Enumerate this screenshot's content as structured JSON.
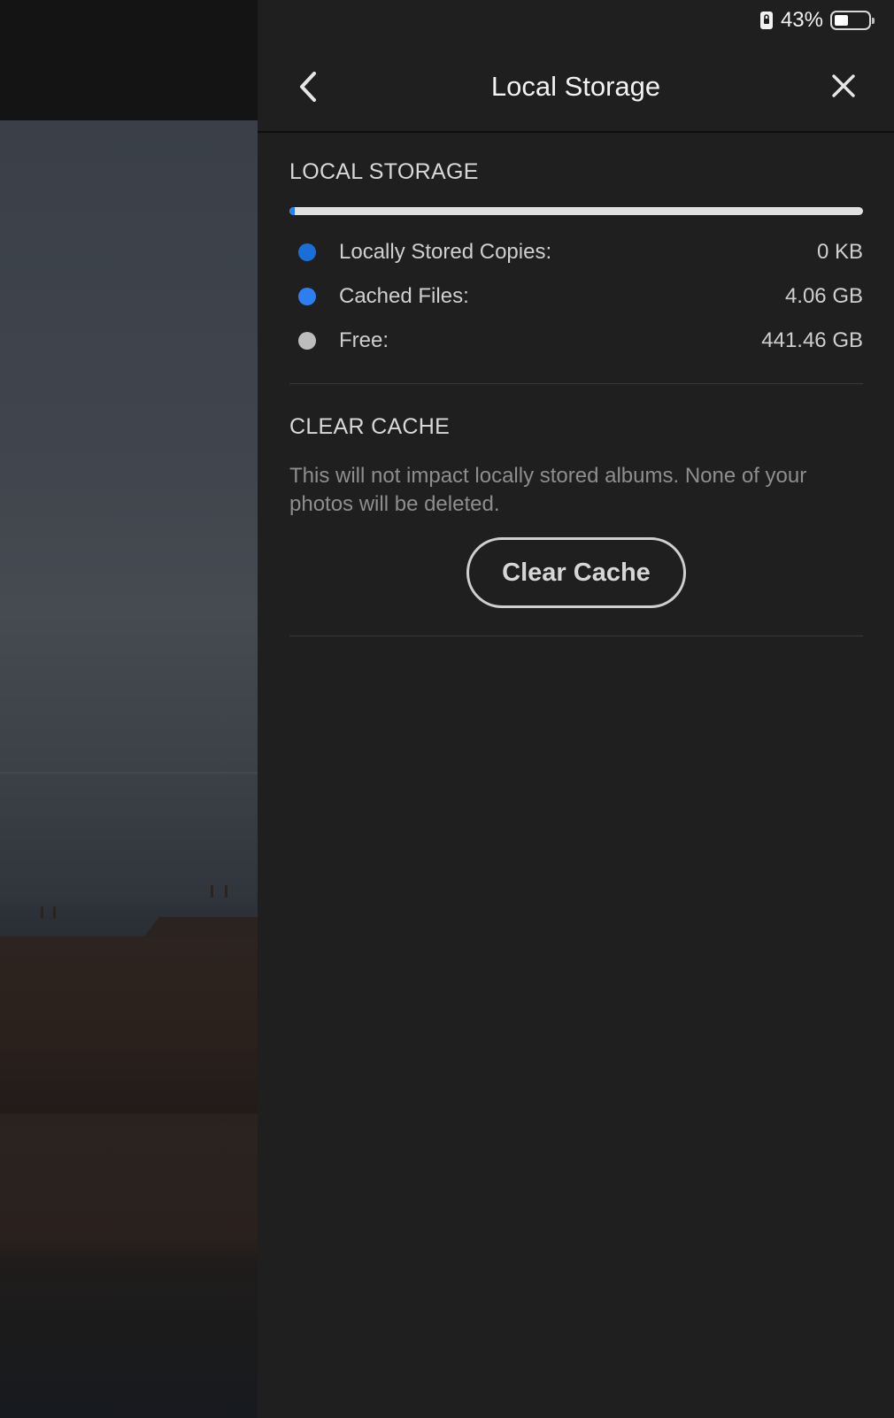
{
  "status_bar": {
    "battery_percent_label": "43%",
    "battery_level": 0.43
  },
  "header": {
    "title": "Local Storage"
  },
  "local_storage": {
    "heading": "LOCAL STORAGE",
    "usage": {
      "locally_stored_fraction": 0.0,
      "cached_fraction": 0.009
    },
    "items": [
      {
        "label": "Locally Stored Copies:",
        "value": "0 KB",
        "color": "#1a6ed8"
      },
      {
        "label": "Cached Files:",
        "value": "4.06 GB",
        "color": "#2d7ff0"
      },
      {
        "label": "Free:",
        "value": "441.46 GB",
        "color": "#bdbdbd"
      }
    ]
  },
  "clear_cache": {
    "heading": "CLEAR CACHE",
    "description": "This will not impact locally stored albums. None of your photos will be deleted.",
    "button_label": "Clear Cache"
  },
  "colors": {
    "panel_bg": "#1f1f1f",
    "accent_blue": "#2d7ff0",
    "bar_track": "#e0e0e0"
  },
  "icons": {
    "back": "chevron-left-icon",
    "close": "close-icon",
    "orientation_lock": "orientation-lock-icon",
    "battery": "battery-icon"
  }
}
